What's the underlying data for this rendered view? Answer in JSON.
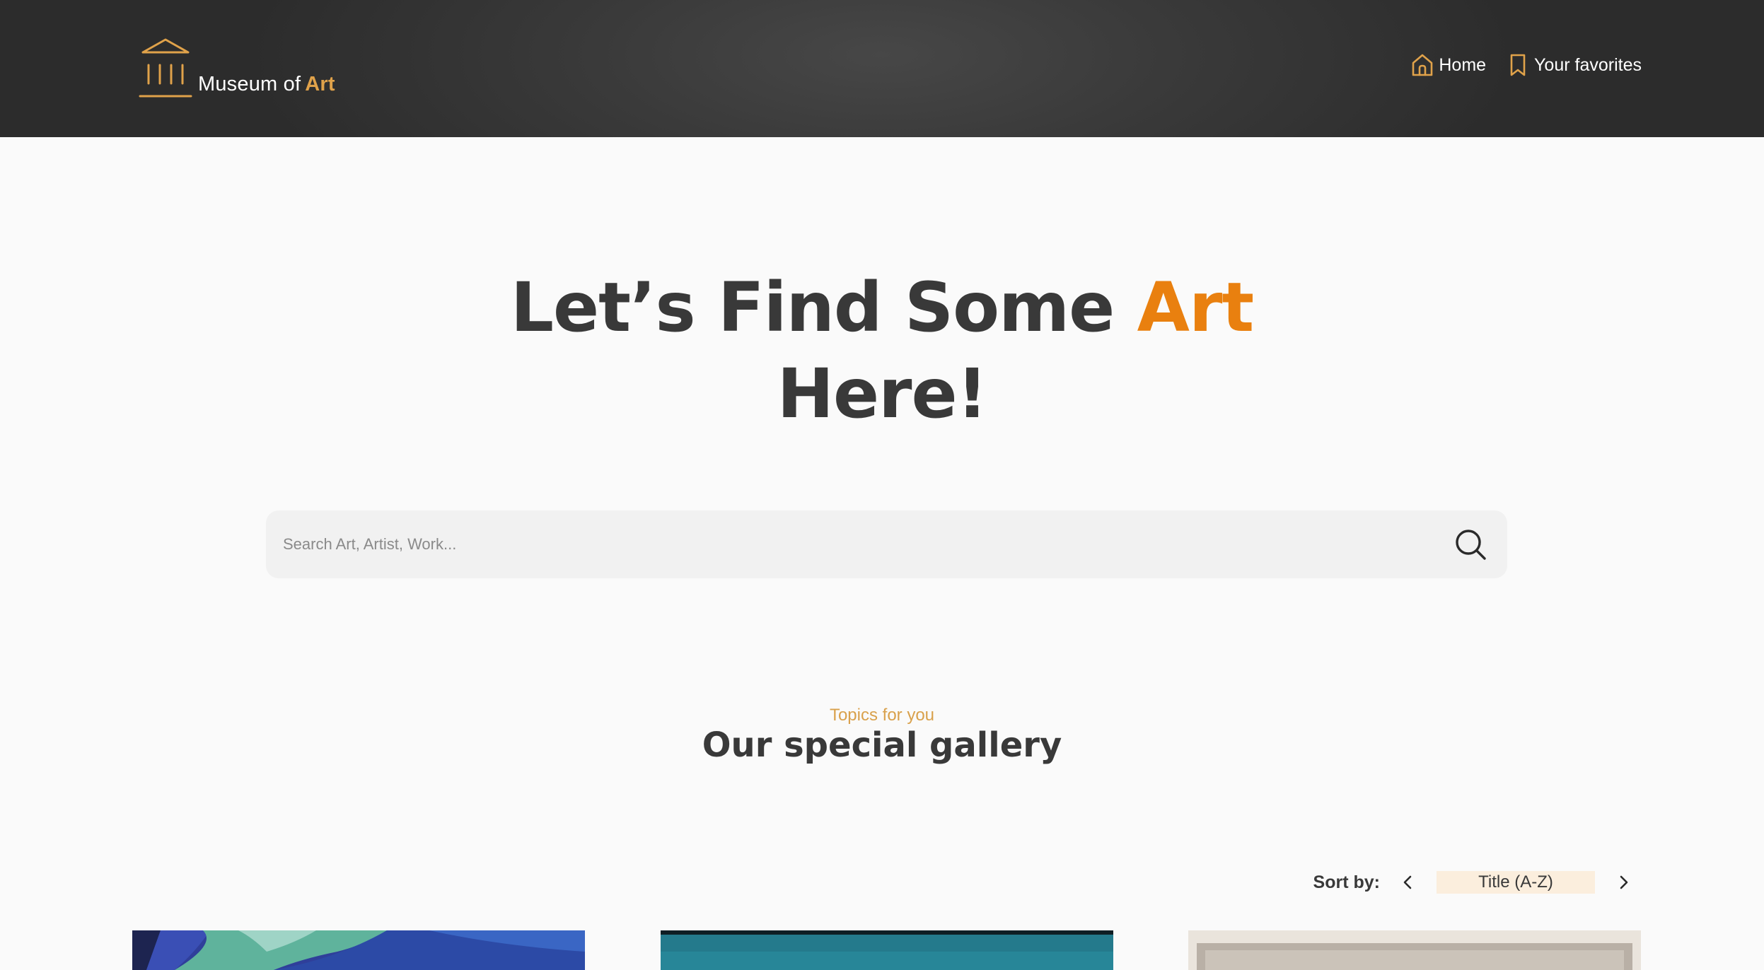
{
  "header": {
    "logo": {
      "text": "Museum of",
      "accent": "Art",
      "icon": "museum-columns-icon"
    },
    "nav": [
      {
        "label": "Home",
        "icon": "home-icon"
      },
      {
        "label": "Your favorites",
        "icon": "bookmark-icon"
      }
    ]
  },
  "hero": {
    "title_part1": "Let’s Find Some",
    "title_accent": "Art",
    "title_part2": "Here!"
  },
  "search": {
    "placeholder": "Search Art, Artist, Work...",
    "value": "",
    "icon": "search-icon"
  },
  "gallery": {
    "kicker": "Topics for you",
    "title": "Our special gallery"
  },
  "sort": {
    "label": "Sort by:",
    "value": "Title (A-Z)",
    "prev_icon": "chevron-left-icon",
    "next_icon": "chevron-right-icon"
  },
  "colors": {
    "accent_orange": "#e9800f",
    "accent_gold": "#e0a24a",
    "kicker_gold": "#d9a14c",
    "header_dark": "#2c2c2c",
    "text_dark": "#393939",
    "sort_highlight": "#fbeedd",
    "search_bg": "#f1f1f1",
    "page_bg": "#fafafa"
  }
}
